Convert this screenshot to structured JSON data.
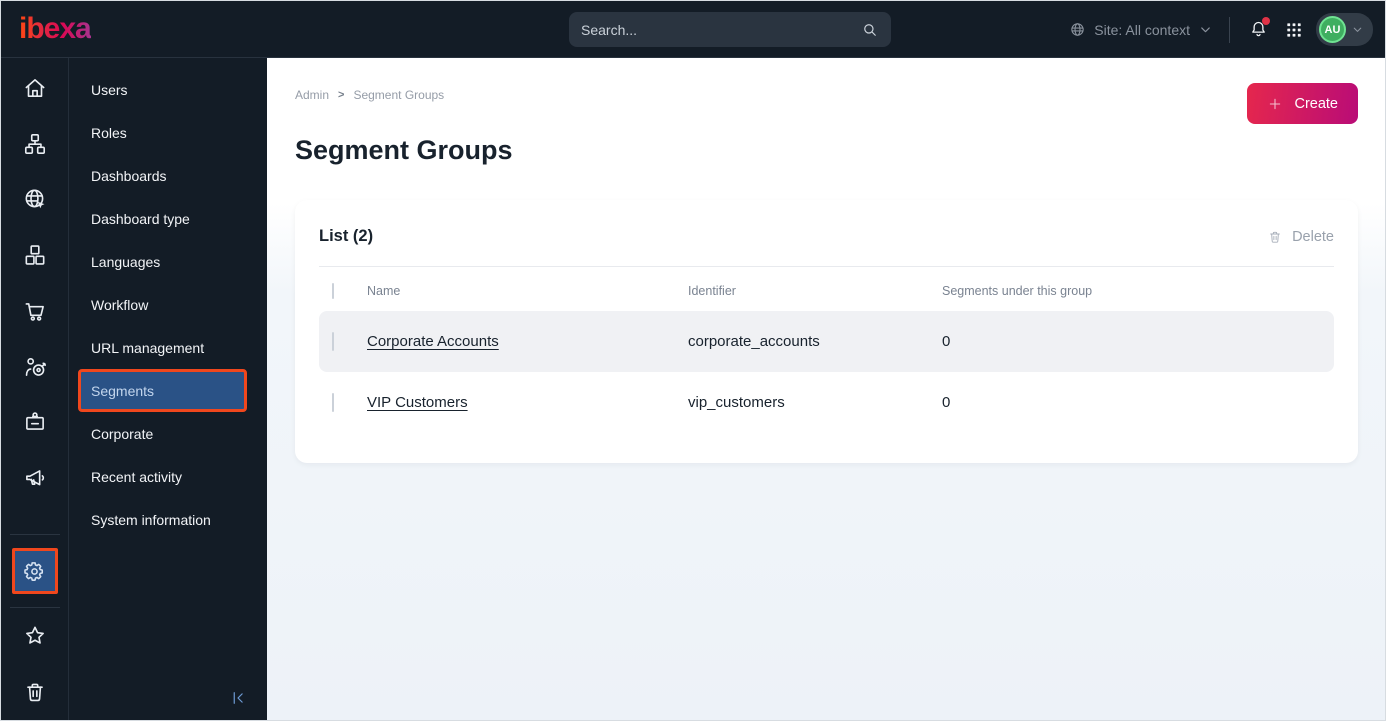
{
  "topbar": {
    "logo": "ibexa",
    "search_placeholder": "Search...",
    "site_context_label": "Site: All context",
    "avatar_initials": "AU"
  },
  "rail": {
    "icons": [
      "home",
      "content-tree",
      "site-globe",
      "blocks",
      "commerce-cart",
      "audience-target",
      "id-badge",
      "megaphone",
      "settings-gear",
      "favorites-star",
      "trash"
    ],
    "active_icon": "settings-gear"
  },
  "sidebar": {
    "items": [
      "Users",
      "Roles",
      "Dashboards",
      "Dashboard type",
      "Languages",
      "Workflow",
      "URL management",
      "Segments",
      "Corporate",
      "Recent activity",
      "System information"
    ],
    "active_item": "Segments"
  },
  "main": {
    "breadcrumb": [
      "Admin",
      "Segment Groups"
    ],
    "title": "Segment Groups",
    "create_button": "Create",
    "list": {
      "title": "List (2)",
      "delete_button": "Delete",
      "columns": [
        "Name",
        "Identifier",
        "Segments under this group"
      ],
      "rows": [
        {
          "name": "Corporate Accounts",
          "identifier": "corporate_accounts",
          "segments": "0"
        },
        {
          "name": "VIP Customers",
          "identifier": "vip_customers",
          "segments": "0"
        }
      ]
    }
  },
  "colors": {
    "topbar_bg": "#131C26",
    "highlight_border_orange": "#F0471D",
    "active_blue": "#2A5286",
    "create_gradient": [
      "#E5274D",
      "#B90C77"
    ],
    "logo_gradient": [
      "#FF4713",
      "#DB0853",
      "#A8348F"
    ],
    "avatar_green": "#3FAE60",
    "notification_red": "#E03347",
    "row_stripe": "#F0F1F4"
  }
}
